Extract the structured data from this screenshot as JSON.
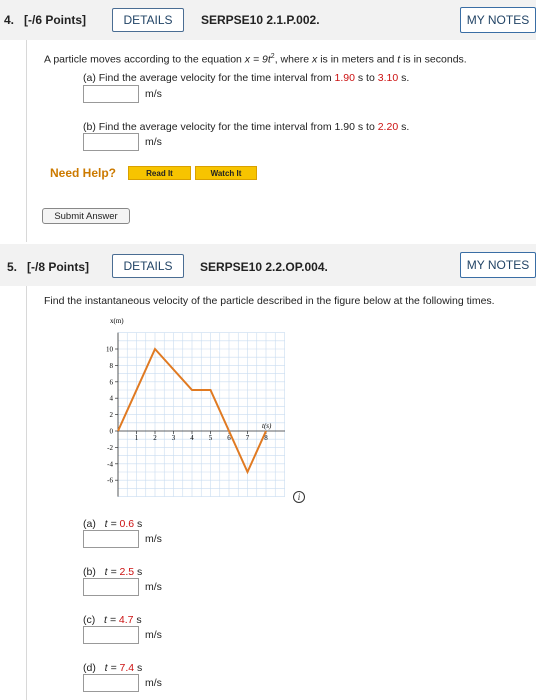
{
  "q4": {
    "number": "4.",
    "points": "[-/6 Points]",
    "details_label": "DETAILS",
    "code": "SERPSE10 2.1.P.002.",
    "my_notes_label": "MY NOTES",
    "prompt_a": "A particle moves according to the equation ",
    "prompt_eq": "x = 9t",
    "prompt_exp": "2",
    "prompt_b": ", where ",
    "prompt_x": "x",
    "prompt_c": " is in meters and ",
    "prompt_t": "t",
    "prompt_d": " is in seconds.",
    "part_a_text": "(a) Find the average velocity for the time interval from ",
    "part_a_v1": "1.90",
    "part_a_s1": " s to ",
    "part_a_v2": "3.10",
    "part_a_s2": " s.",
    "part_a_unit": "m/s",
    "part_b_text": "(b) Find the average velocity for the time interval from 1.90 s to ",
    "part_b_v": "2.20",
    "part_b_s": " s.",
    "part_b_unit": "m/s",
    "need_help": "Need Help?",
    "read_it": "Read It",
    "watch_it": "Watch It",
    "submit": "Submit Answer"
  },
  "q5": {
    "number": "5.",
    "points": "[-/8 Points]",
    "details_label": "DETAILS",
    "code": "SERPSE10 2.2.OP.004.",
    "my_notes_label": "MY NOTES",
    "prompt": "Find the instantaneous velocity of the particle described in the figure below at the following times.",
    "parts": [
      {
        "label": "(a)",
        "t": "t = ",
        "val": "0.6",
        "s": " s",
        "unit": "m/s"
      },
      {
        "label": "(b)",
        "t": "t = ",
        "val": "2.5",
        "s": " s",
        "unit": "m/s"
      },
      {
        "label": "(c)",
        "t": "t = ",
        "val": "4.7",
        "s": " s",
        "unit": "m/s"
      },
      {
        "label": "(d)",
        "t": "t = ",
        "val": "7.4",
        "s": " s",
        "unit": "m/s"
      }
    ]
  },
  "figure": {
    "y_axis_label": "x(m)",
    "x_axis_label": "t(s)",
    "y_ticks": [
      "10",
      "8",
      "6",
      "4",
      "2",
      "0",
      "-2",
      "-4",
      "-6"
    ],
    "x_ticks": [
      "1",
      "2",
      "3",
      "4",
      "5",
      "6",
      "7",
      "8"
    ],
    "line_color": "#e07a22",
    "points": [
      [
        0,
        0
      ],
      [
        2,
        10
      ],
      [
        4,
        5
      ],
      [
        5,
        5
      ],
      [
        7,
        -5
      ],
      [
        8,
        0
      ]
    ]
  },
  "colors": {
    "accent_red": "#cc1111",
    "help_orange": "#cc7a00",
    "button_yellow": "#f7c400"
  }
}
